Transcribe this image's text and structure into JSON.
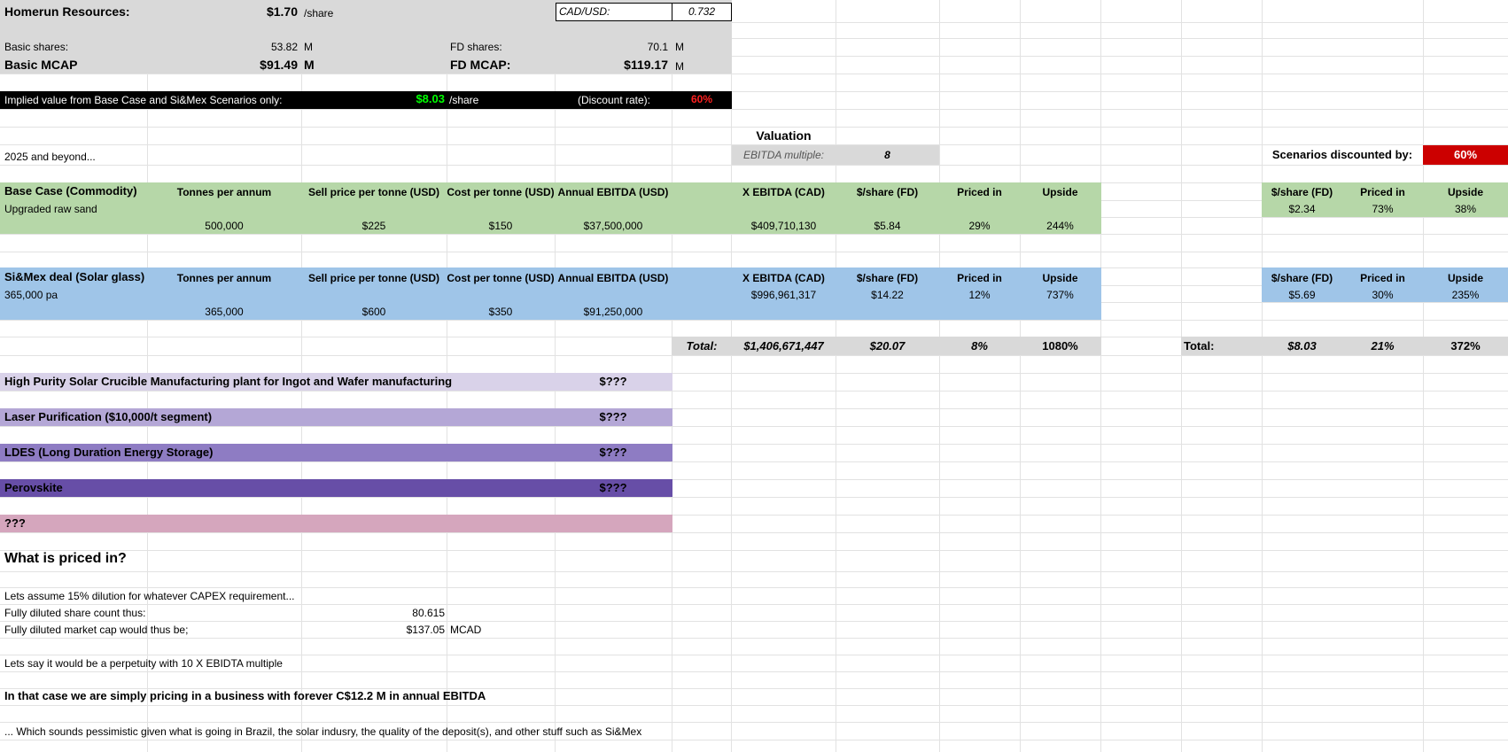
{
  "header": {
    "company": "Homerun Resources:",
    "price": "$1.70",
    "price_unit": "/share",
    "fx_label": "CAD/USD:",
    "fx_value": "0.732",
    "basic_shares_label": "Basic shares:",
    "basic_shares_value": "53.82",
    "basic_shares_unit": "M",
    "fd_shares_label": "FD shares:",
    "fd_shares_value": "70.1",
    "fd_shares_unit": "M",
    "basic_mcap_label": "Basic MCAP",
    "basic_mcap_value": "$91.49",
    "basic_mcap_unit": "M",
    "fd_mcap_label": "FD MCAP:",
    "fd_mcap_value": "$119.17",
    "fd_mcap_unit": "M"
  },
  "implied": {
    "label": "Implied value from Base Case and Si&Mex Scenarios only:",
    "value": "$8.03",
    "unit": "/share",
    "discount_label": "(Discount rate):",
    "discount_value": "60%"
  },
  "valuation": {
    "title": "Valuation",
    "multiple_label": "EBITDA multiple:",
    "multiple_value": "8",
    "period_label": "2025 and beyond...",
    "scenarios_label": "Scenarios discounted by:",
    "scenarios_value": "60%"
  },
  "columns": {
    "tonnes": "Tonnes per annum",
    "sell": "Sell price per tonne (USD)",
    "cost": "Cost per tonne (USD)",
    "ebitda": "Annual EBITDA (USD)",
    "x_ebitda": "X EBITDA (CAD)",
    "per_share": "$/share (FD)",
    "priced_in": "Priced in",
    "upside": "Upside"
  },
  "base_case": {
    "title": "Base Case (Commodity)",
    "subtitle": "Upgraded raw sand",
    "tonnes": "500,000",
    "sell": "$225",
    "cost": "$150",
    "ebitda": "$37,500,000",
    "x_ebitda": "$409,710,130",
    "per_share": "$5.84",
    "priced_in": "29%",
    "upside": "244%",
    "d_per_share": "$2.34",
    "d_priced_in": "73%",
    "d_upside": "38%"
  },
  "simex": {
    "title": "Si&Mex deal (Solar glass)",
    "subtitle": "365,000 pa",
    "tonnes": "365,000",
    "sell": "$600",
    "cost": "$350",
    "ebitda": "$91,250,000",
    "x_ebitda": "$996,961,317",
    "per_share": "$14.22",
    "priced_in": "12%",
    "upside": "737%",
    "d_per_share": "$5.69",
    "d_priced_in": "30%",
    "d_upside": "235%"
  },
  "totals": {
    "label": "Total:",
    "x_ebitda": "$1,406,671,447",
    "per_share": "$20.07",
    "priced_in": "8%",
    "upside": "1080%",
    "d_label": "Total:",
    "d_per_share": "$8.03",
    "d_priced_in": "21%",
    "d_upside": "372%"
  },
  "opportunities": [
    {
      "label": "High Purity Solar Crucible Manufacturing plant for Ingot and Wafer manufacturing",
      "value": "$???",
      "color": "#d9d2e9"
    },
    {
      "label": "Laser Purification ($10,000/t segment)",
      "value": "$???",
      "color": "#b4a7d6"
    },
    {
      "label": "LDES (Long Duration Energy Storage)",
      "value": "$???",
      "color": "#8e7cc3"
    },
    {
      "label": "Perovskite",
      "value": "$???",
      "color": "#674ea7"
    },
    {
      "label": "???",
      "value": "",
      "color": "#d5a6bd"
    }
  ],
  "priced_in_section": {
    "title": "What is priced in?",
    "line1": "Lets assume 15% dilution for whatever CAPEX requirement...",
    "line2_label": "Fully diluted share count thus:",
    "line2_value": "80.615",
    "line3_label": "Fully diluted market cap would thus be;",
    "line3_value": "$137.05",
    "line3_unit": "MCAD",
    "line4": "Lets say it would be a perpetuity with 10 X EBIDTA multiple",
    "line5": "In that case we are simply pricing in a business with forever C$12.2 M in annual EBITDA",
    "line6": "... Which sounds pessimistic given what is going in Brazil, the solar indusry, the quality of the deposit(s), and other stuff such as Si&Mex"
  }
}
